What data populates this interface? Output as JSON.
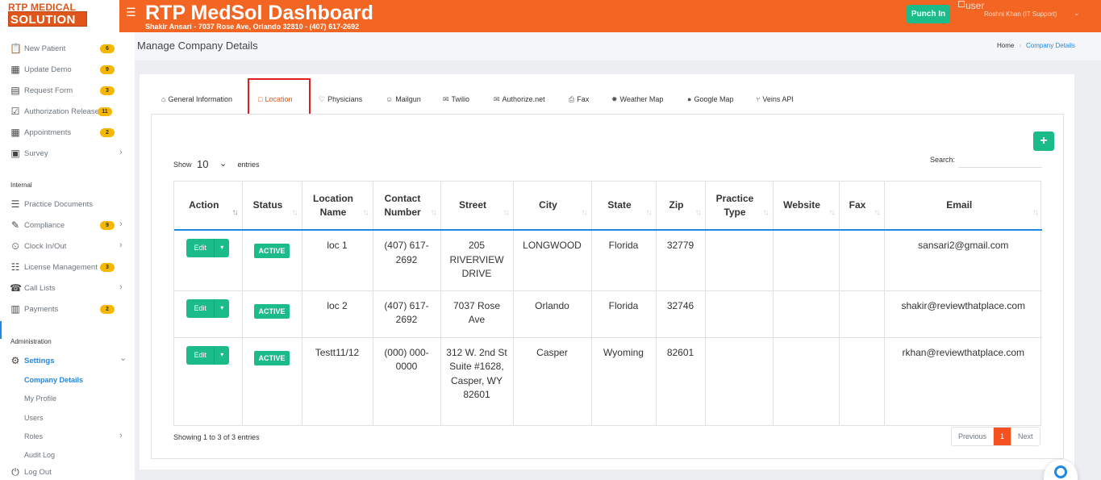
{
  "logo": {
    "line1": "RTP MEDICAL",
    "line2": "SOLUTION"
  },
  "header": {
    "title": "RTP MedSol Dashboard",
    "subtitle": "Shakir Ansari - 7037 Rose Ave, Orlando 32810 - (407) 617-2692",
    "punch_in_label": "Punch In",
    "user_img_alt": "user",
    "user_name": "Roshni Khan (IT Support)",
    "menu_icon": "hamburger-icon",
    "user_caret_icon": "chevron-down-icon"
  },
  "sidebar": {
    "items": [
      {
        "label": "New Patient",
        "badge": "6",
        "icon": "clipboard-icon"
      },
      {
        "label": "Update Demo",
        "badge": "9",
        "icon": "calendar-icon"
      },
      {
        "label": "Request Form",
        "badge": "3",
        "icon": "form-icon"
      },
      {
        "label": "Authorization Release",
        "badge": "11",
        "icon": "document-check-icon"
      },
      {
        "label": "Appointments",
        "badge": "2",
        "icon": "calendar-add-icon"
      },
      {
        "label": "Survey",
        "badge": "",
        "icon": "survey-icon"
      }
    ],
    "internal_heading": "Internal",
    "internal_items": [
      {
        "label": "Practice Documents",
        "badge": "",
        "icon": "documents-icon"
      },
      {
        "label": "Compliance",
        "badge": "9",
        "icon": "pencil-icon"
      },
      {
        "label": "Clock In/Out",
        "badge": "",
        "icon": "clock-user-icon"
      },
      {
        "label": "License Management",
        "badge": "3",
        "icon": "license-icon"
      },
      {
        "label": "Call Lists",
        "badge": "",
        "icon": "phone-list-icon"
      },
      {
        "label": "Payments",
        "badge": "2",
        "icon": "money-icon"
      }
    ],
    "admin_heading": "Administration",
    "settings_label": "Settings",
    "settings_sub": [
      "Company Details",
      "My Profile",
      "Users",
      "Roles",
      "Audit Log"
    ],
    "logout_label": "Log Out"
  },
  "page": {
    "title": "Manage Company Details",
    "breadcrumb": [
      "Home",
      "Company Details"
    ]
  },
  "tabs": [
    {
      "label": "General Information",
      "icon": "home-icon"
    },
    {
      "label": "Location",
      "icon": "map-icon"
    },
    {
      "label": "Physicians",
      "icon": "heart-icon"
    },
    {
      "label": "Mailgun",
      "icon": "user-icon"
    },
    {
      "label": "Twilio",
      "icon": "envelope-icon"
    },
    {
      "label": "Authorize.net",
      "icon": "envelope-icon"
    },
    {
      "label": "Fax",
      "icon": "fax-icon"
    },
    {
      "label": "Weather Map",
      "icon": "sun-icon"
    },
    {
      "label": "Google Map",
      "icon": "map-marker-icon"
    },
    {
      "label": "Veins API",
      "icon": "git-branch-icon"
    }
  ],
  "table_controls": {
    "show_label": "Show",
    "entries_value": "10",
    "entries_label": "entries",
    "search_label": "Search:",
    "search_value": "",
    "add_label": "+"
  },
  "table": {
    "columns": [
      "Action",
      "Status",
      "Location Name",
      "Contact Number",
      "Street",
      "City",
      "State",
      "Zip",
      "Practice Type",
      "Website",
      "Fax",
      "Email"
    ],
    "rows": [
      {
        "action": "Edit",
        "status": "ACTIVE",
        "location_name": "loc 1",
        "contact": "(407) 617-2692",
        "street": "205 RIVERVIEW DRIVE",
        "city": "LONGWOOD",
        "state": "Florida",
        "zip": "32779",
        "practice_type": "",
        "website": "",
        "fax": "",
        "email": "sansari2@gmail.com"
      },
      {
        "action": "Edit",
        "status": "ACTIVE",
        "location_name": "loc 2",
        "contact": "(407) 617-2692",
        "street": "7037 Rose Ave",
        "city": "Orlando",
        "state": "Florida",
        "zip": "32746",
        "practice_type": "",
        "website": "",
        "fax": "",
        "email": "shakir@reviewthatplace.com"
      },
      {
        "action": "Edit",
        "status": "ACTIVE",
        "location_name": "Testt11/12",
        "contact": "(000) 000-0000",
        "street": "312 W. 2nd St Suite #1628, Casper, WY 82601",
        "city": "Casper",
        "state": "Wyoming",
        "zip": "82601",
        "practice_type": "",
        "website": "",
        "fax": "",
        "email": "rkhan@reviewthatplace.com"
      }
    ]
  },
  "footer": {
    "info": "Showing 1 to 3 of 3 entries",
    "previous": "Previous",
    "current_page": "1",
    "next": "Next"
  },
  "colors": {
    "brand": "#f26522",
    "accent": "#1bbc8a",
    "link": "#1e88e5",
    "badge": "#f5b700"
  }
}
